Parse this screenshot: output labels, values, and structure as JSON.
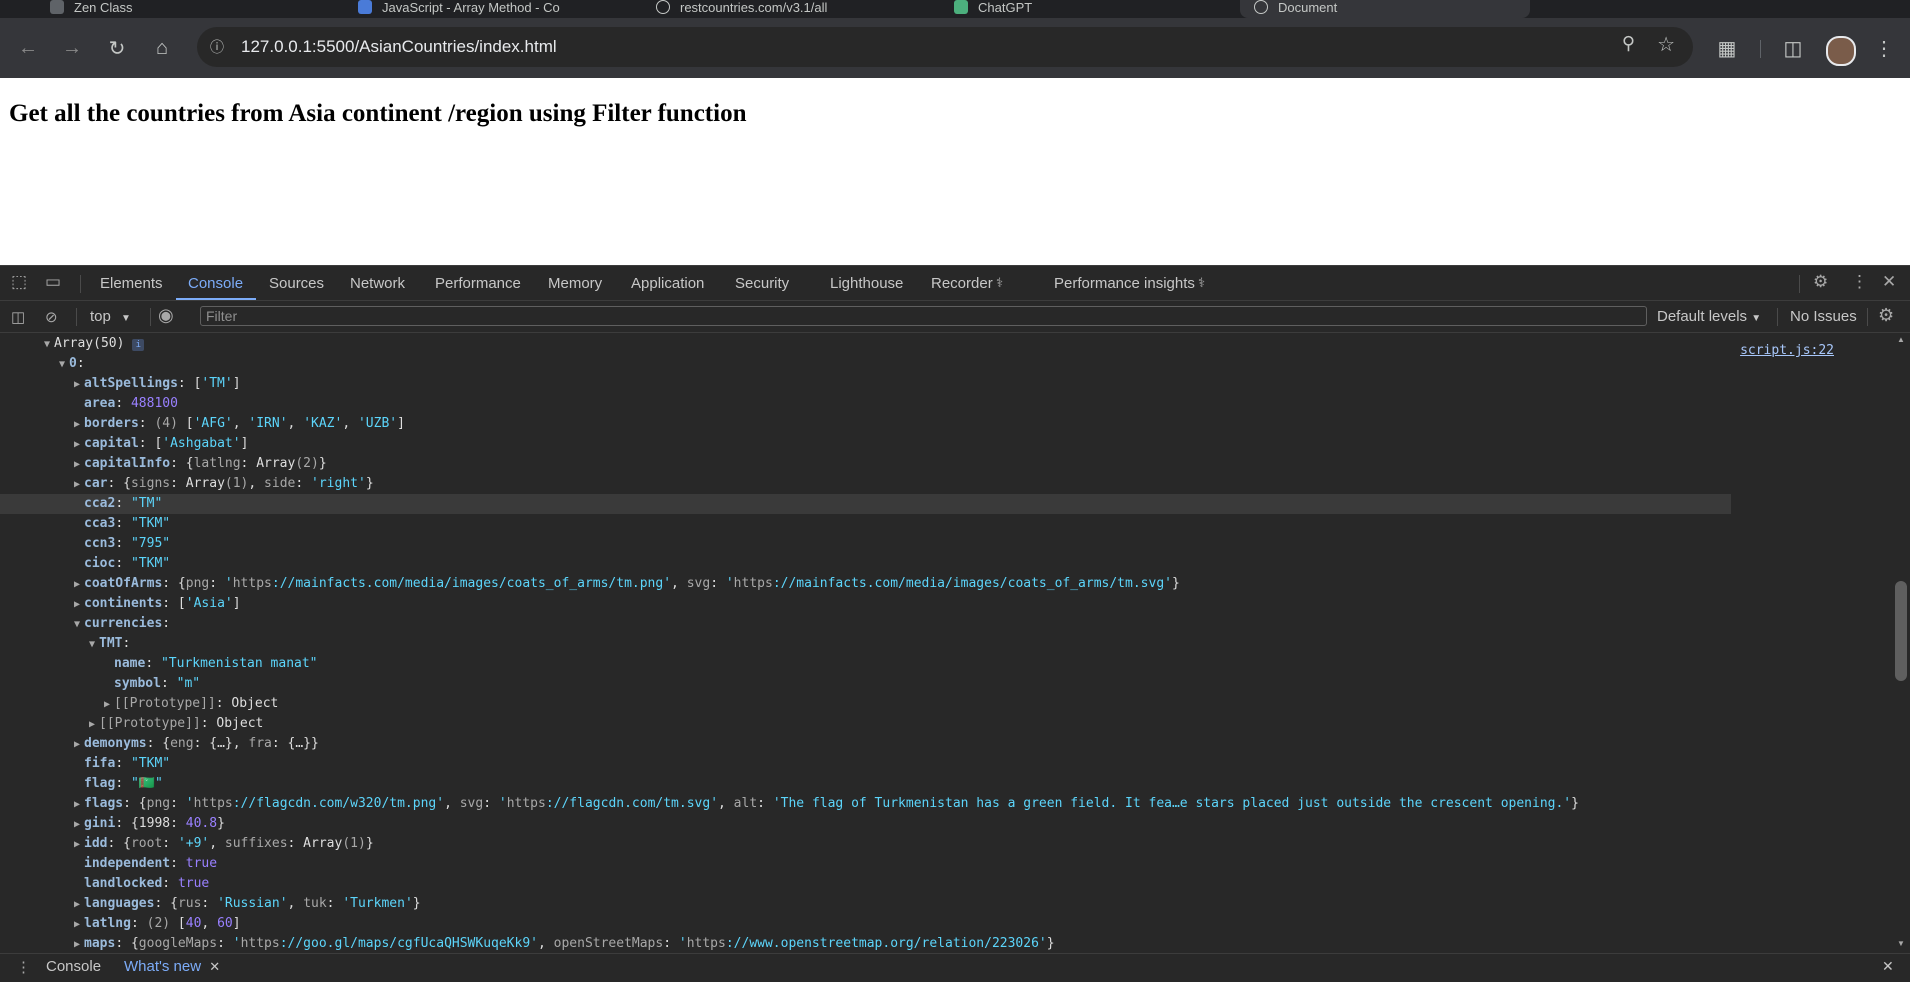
{
  "tabs": [
    {
      "label": "Zen Class"
    },
    {
      "label": "JavaScript - Array Method - Co"
    },
    {
      "label": "restcountries.com/v3.1/all"
    },
    {
      "label": "ChatGPT"
    },
    {
      "label": "Document"
    }
  ],
  "address": {
    "url": "127.0.0.1:5500/AsianCountries/index.html"
  },
  "page": {
    "heading": "Get all the countries from Asia continent /region using Filter function"
  },
  "devtools": {
    "tabs": [
      "Elements",
      "Console",
      "Sources",
      "Network",
      "Performance",
      "Memory",
      "Application",
      "Security",
      "Lighthouse",
      "Recorder",
      "Performance insights"
    ],
    "active_tab": "Console",
    "context": "top",
    "filter_placeholder": "Filter",
    "levels": "Default levels",
    "issues": "No Issues",
    "source_link": "script.js:22",
    "drawer_tabs": [
      "Console",
      "What's new"
    ]
  },
  "console_lines": [
    {
      "indent": 0,
      "arrow": "down",
      "key": "",
      "html_text": "Array(50)"
    },
    {
      "indent": 1,
      "arrow": "down",
      "key": "0",
      "rest": ""
    },
    {
      "indent": 2,
      "arrow": "right",
      "key": "altSpellings",
      "rest": "['TM']"
    },
    {
      "indent": 2,
      "arrow": "",
      "key": "area",
      "rest": "488100"
    },
    {
      "indent": 2,
      "arrow": "right",
      "key": "borders",
      "rest": "(4) ['AFG', 'IRN', 'KAZ', 'UZB']"
    },
    {
      "indent": 2,
      "arrow": "right",
      "key": "capital",
      "rest": "['Ashgabat']"
    },
    {
      "indent": 2,
      "arrow": "right",
      "key": "capitalInfo",
      "rest": "{latlng: Array(2)}"
    },
    {
      "indent": 2,
      "arrow": "right",
      "key": "car",
      "rest": "{signs: Array(1), side: 'right'}"
    },
    {
      "indent": 2,
      "arrow": "",
      "key": "cca2",
      "rest": "\"TM\""
    },
    {
      "indent": 2,
      "arrow": "",
      "key": "cca3",
      "rest": "\"TKM\""
    },
    {
      "indent": 2,
      "arrow": "",
      "key": "ccn3",
      "rest": "\"795\""
    },
    {
      "indent": 2,
      "arrow": "",
      "key": "cioc",
      "rest": "\"TKM\""
    },
    {
      "indent": 2,
      "arrow": "right",
      "key": "coatOfArms",
      "rest": "{png: 'https://mainfacts.com/media/images/coats_of_arms/tm.png', svg: 'https://mainfacts.com/media/images/coats_of_arms/tm.svg'}"
    },
    {
      "indent": 2,
      "arrow": "right",
      "key": "continents",
      "rest": "['Asia']"
    },
    {
      "indent": 2,
      "arrow": "down",
      "key": "currencies",
      "rest": ""
    },
    {
      "indent": 3,
      "arrow": "down",
      "key": "TMT",
      "rest": ""
    },
    {
      "indent": 4,
      "arrow": "",
      "key": "name",
      "rest": "\"Turkmenistan manat\""
    },
    {
      "indent": 4,
      "arrow": "",
      "key": "symbol",
      "rest": "\"m\""
    },
    {
      "indent": 4,
      "arrow": "right",
      "key": "[[Prototype]]",
      "rest": "Object"
    },
    {
      "indent": 3,
      "arrow": "right",
      "key": "[[Prototype]]",
      "rest": "Object"
    },
    {
      "indent": 2,
      "arrow": "right",
      "key": "demonyms",
      "rest": "{eng: {…}, fra: {…}}"
    },
    {
      "indent": 2,
      "arrow": "",
      "key": "fifa",
      "rest": "\"TKM\""
    },
    {
      "indent": 2,
      "arrow": "",
      "key": "flag",
      "rest": "\"🇹🇲\""
    },
    {
      "indent": 2,
      "arrow": "right",
      "key": "flags",
      "rest": "{png: 'https://flagcdn.com/w320/tm.png', svg: 'https://flagcdn.com/tm.svg', alt: 'The flag of Turkmenistan has a green field. It fea…e stars placed just outside the crescent opening.'}"
    },
    {
      "indent": 2,
      "arrow": "right",
      "key": "gini",
      "rest": "{1998: 40.8}"
    },
    {
      "indent": 2,
      "arrow": "right",
      "key": "idd",
      "rest": "{root: '+9', suffixes: Array(1)}"
    },
    {
      "indent": 2,
      "arrow": "",
      "key": "independent",
      "rest": "true"
    },
    {
      "indent": 2,
      "arrow": "",
      "key": "landlocked",
      "rest": "true"
    },
    {
      "indent": 2,
      "arrow": "right",
      "key": "languages",
      "rest": "{rus: 'Russian', tuk: 'Turkmen'}"
    },
    {
      "indent": 2,
      "arrow": "right",
      "key": "latlng",
      "rest": "(2) [40, 60]"
    },
    {
      "indent": 2,
      "arrow": "right",
      "key": "maps",
      "rest": "{googleMaps: 'https://goo.gl/maps/cgfUcaQHSWKuqeKk9', openStreetMaps: 'https://www.openstreetmap.org/relation/223026'}"
    }
  ]
}
